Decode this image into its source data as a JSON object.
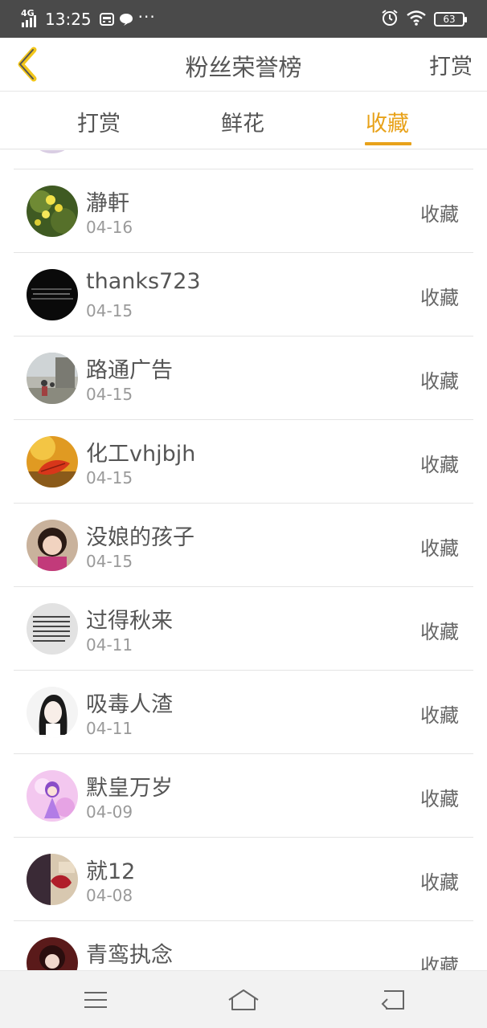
{
  "status_bar": {
    "network": "4G",
    "time": "13:25",
    "battery": "63",
    "icons": [
      "signal-icon",
      "app-notification-icon",
      "chat-icon",
      "more-dots-icon",
      "alarm-icon",
      "wifi-icon",
      "battery-icon"
    ]
  },
  "header": {
    "back_icon": "chevron-left-icon",
    "title": "粉丝荣誉榜",
    "reward_label": "打赏"
  },
  "tabs": [
    {
      "label": "打赏",
      "active": false
    },
    {
      "label": "鲜花",
      "active": false
    },
    {
      "label": "收藏",
      "active": true
    }
  ],
  "colors": {
    "accent": "#e8a21a",
    "status_bar": "#4a4a4a",
    "text": "#555555",
    "date": "#9a9a9a",
    "divider": "#e4e4e4",
    "navbar": "#f2f2f2"
  },
  "list": [
    {
      "name": "",
      "date": "",
      "action": "收藏"
    },
    {
      "name": "瀞軒",
      "date": "04-16",
      "action": "收藏"
    },
    {
      "name": "thanks723",
      "date": "04-15",
      "action": "收藏"
    },
    {
      "name": "路通广告",
      "date": "04-15",
      "action": "收藏"
    },
    {
      "name": "化工vhjbjh",
      "date": "04-15",
      "action": "收藏"
    },
    {
      "name": "没娘的孩子",
      "date": "04-15",
      "action": "收藏"
    },
    {
      "name": "过得秋来",
      "date": "04-11",
      "action": "收藏"
    },
    {
      "name": "吸毒人渣",
      "date": "04-11",
      "action": "收藏"
    },
    {
      "name": "默皇万岁",
      "date": "04-09",
      "action": "收藏"
    },
    {
      "name": "就12",
      "date": "04-08",
      "action": "收藏"
    },
    {
      "name": "青鸾执念",
      "date": "",
      "action": "收藏"
    }
  ],
  "navbar": {
    "icons": [
      "menu-icon",
      "home-icon",
      "back-icon"
    ]
  }
}
